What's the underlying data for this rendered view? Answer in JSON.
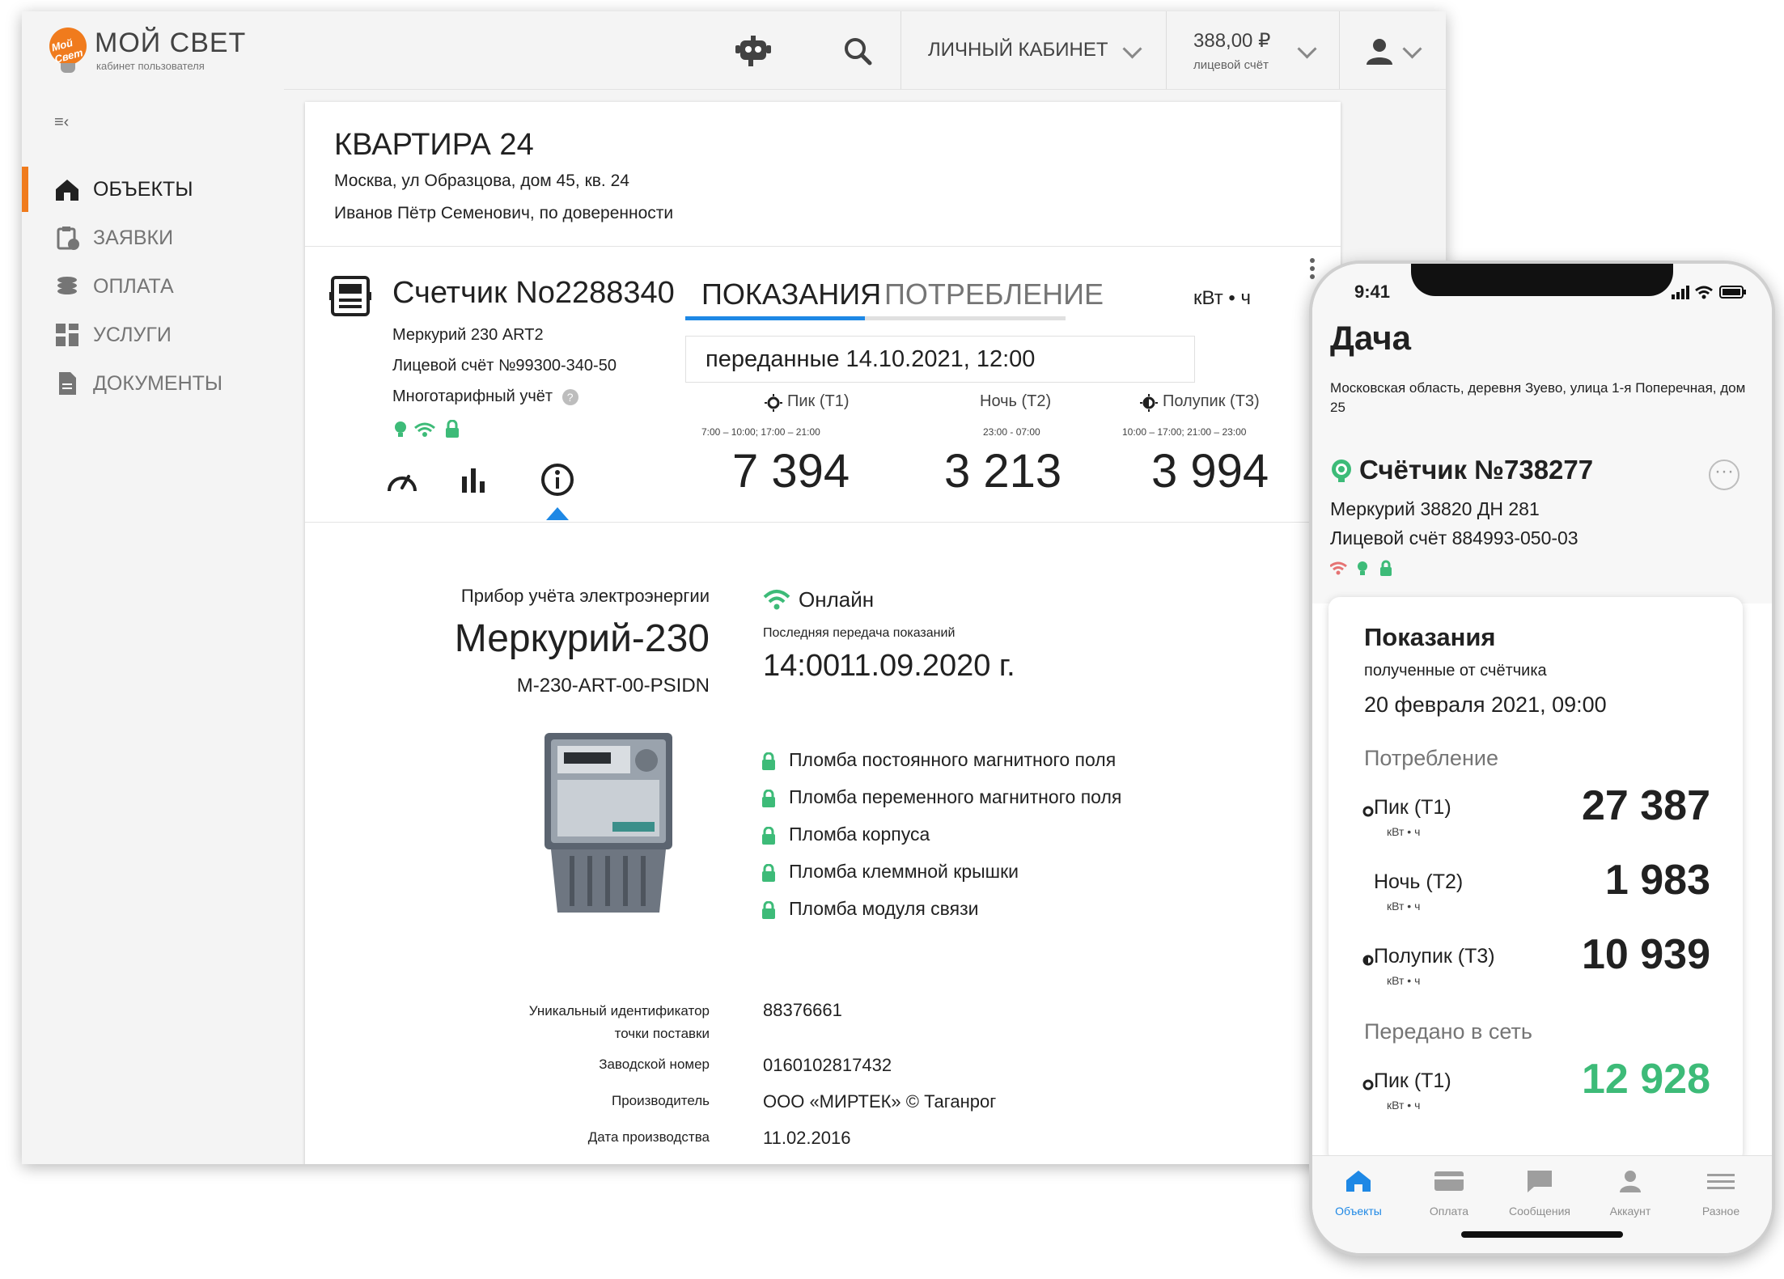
{
  "app": {
    "name": "МОЙ СВЕТ",
    "subtitle": "кабинет пользователя",
    "logo_text": "Мой Свет",
    "account_menu": "ЛИЧНЫЙ КАБИНЕТ",
    "balance": "388,00 ₽",
    "balance_label": "лицевой счёт",
    "accent_color": "#f07b1d",
    "blue_color": "#1e88e5",
    "green_color": "#3dbb78"
  },
  "sidebar": {
    "items": [
      {
        "label": "ОБЪЕКТЫ",
        "icon": "home-icon",
        "active": true
      },
      {
        "label": "ЗАЯВКИ",
        "icon": "clipboard-icon",
        "active": false
      },
      {
        "label": "ОПЛАТА",
        "icon": "coins-icon",
        "active": false
      },
      {
        "label": "УСЛУГИ",
        "icon": "grid-icon",
        "active": false
      },
      {
        "label": "ДОКУМЕНТЫ",
        "icon": "document-icon",
        "active": false
      }
    ]
  },
  "object": {
    "title": "КВАРТИРА 24",
    "address": "Москва, ул Образцова, дом 45, кв. 24",
    "owner": "Иванов Пётр Семенович, по доверенности"
  },
  "meter": {
    "title": "Счетчик No2288340",
    "model": "Меркурий 230 ART2",
    "account": "Лицевой счёт №99300-340-50",
    "multi_tariff": "Многотарифный учёт",
    "tabs": [
      "ПОКАЗАНИЯ",
      "ПОТРЕБЛЕНИЕ"
    ],
    "unit": "кВт • ч",
    "sent": "переданные 14.10.2021, 12:00",
    "tariffs": [
      {
        "name": "Пик (T1)",
        "hours": "7:00 – 10:00; 17:00 – 21:00",
        "value": "7 394",
        "icon": "sun-icon"
      },
      {
        "name": "Ночь (T2)",
        "hours": "23:00 - 07:00",
        "value": "3 213",
        "icon": "moon-icon"
      },
      {
        "name": "Полупик (T3)",
        "hours": "10:00 – 17:00; 21:00 – 23:00",
        "value": "3 994",
        "icon": "half-sun-icon"
      }
    ]
  },
  "device": {
    "caption": "Прибор учёта электроэнергии",
    "name": "Меркурий-230",
    "code": "M-230-ART-00-PSIDN",
    "status": "Онлайн",
    "last_label": "Последняя передача показаний",
    "last_time": "14:00",
    "last_date": "11.09.2020 г.",
    "seals": [
      "Пломба постоянного магнитного поля",
      "Пломба переменного магнитного поля",
      "Пломба корпуса",
      "Пломба клеммной крышки",
      "Пломба модуля связи"
    ],
    "specs": [
      {
        "label": "Уникальный идентификатор точки поставки",
        "value": "88376661"
      },
      {
        "label": "Заводской номер",
        "value": "0160102817432"
      },
      {
        "label": "Производитель",
        "value": "ООО «МИРТЕК» © Таганрог"
      },
      {
        "label": "Дата производства",
        "value": "11.02.2016"
      }
    ]
  },
  "phone": {
    "time": "9:41",
    "title": "Дача",
    "address": "Московская область, деревня Зуево, улица 1-я Поперечная, дом 25",
    "meter_title": "Счётчик №738277",
    "meter_model": "Меркурий 38820 ДН 281",
    "meter_account": "Лицевой счёт 884993-050-03",
    "card_title": "Показания",
    "card_sub": "полученные от счётчика",
    "card_date": "20 февраля 2021, 09:00",
    "consumption_title": "Потребление",
    "consumption": [
      {
        "name": "Пик (T1)",
        "unit": "кВт • ч",
        "value": "27 387"
      },
      {
        "name": "Ночь (T2)",
        "unit": "кВт • ч",
        "value": "1 983"
      },
      {
        "name": "Полупик (T3)",
        "unit": "кВт • ч",
        "value": "10 939"
      }
    ],
    "grid_title": "Передано в сеть",
    "grid": [
      {
        "name": "Пик (T1)",
        "unit": "кВт • ч",
        "value": "12 928"
      }
    ],
    "tabbar": [
      {
        "label": "Объекты",
        "icon": "home-icon",
        "active": true
      },
      {
        "label": "Оплата",
        "icon": "card-icon",
        "active": false
      },
      {
        "label": "Сообщения",
        "icon": "message-icon",
        "active": false
      },
      {
        "label": "Аккаунт",
        "icon": "person-icon",
        "active": false
      },
      {
        "label": "Разное",
        "icon": "menu-icon",
        "active": false
      }
    ]
  }
}
